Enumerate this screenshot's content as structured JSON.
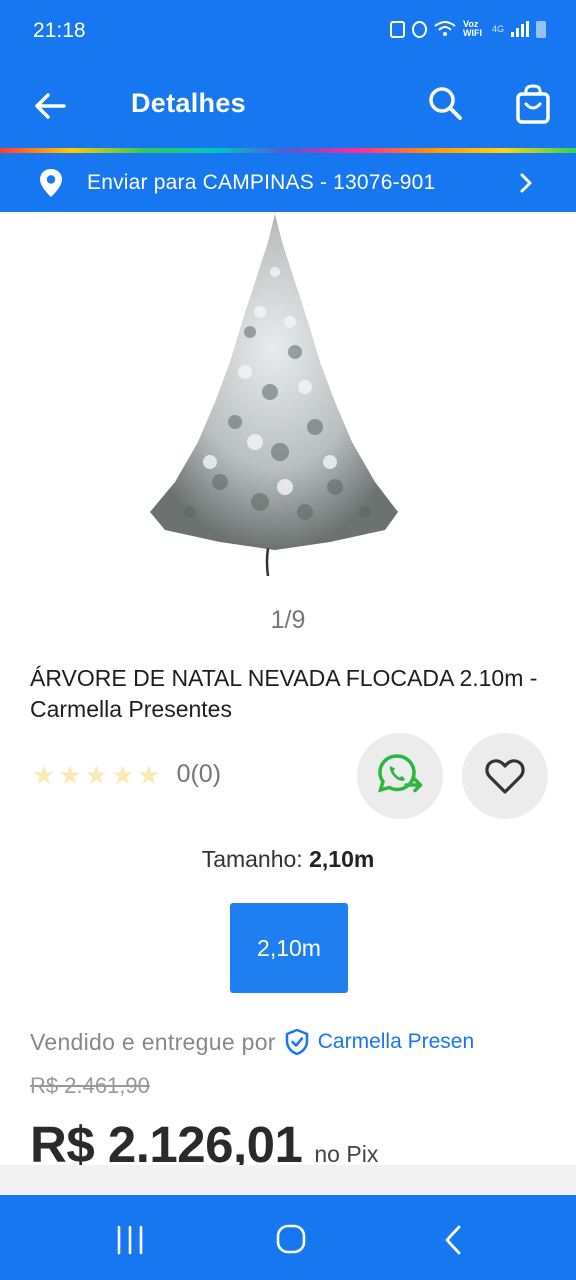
{
  "status_bar": {
    "time": "21:18",
    "network_label": "Voz WIFI",
    "network_type": "4G",
    "icons": [
      "sim-icon",
      "alarm-icon",
      "wifi-calling-icon",
      "signal-icon",
      "battery-icon"
    ]
  },
  "header": {
    "title": "Detalhes",
    "back_icon": "arrow-left-icon",
    "search_icon": "search-icon",
    "cart_icon": "shopping-bag-icon"
  },
  "delivery": {
    "text": "Enviar para CAMPINAS - 13076-901",
    "icon": "location-pin-icon"
  },
  "gallery": {
    "indicator": "1/9"
  },
  "product": {
    "title": "ÁRVORE DE NATAL NEVADA FLOCADA 2.10m - Carmella Presentes",
    "rating_value": 0,
    "rating_text": "0(0)",
    "size_label_prefix": "Tamanho:",
    "size_label_value": "2,10m",
    "size_options": [
      "2,10m"
    ],
    "seller_prefix": "Vendido e entregue por",
    "seller_name": "Carmella Presen",
    "old_price": "R$ 2.461,90",
    "price": "R$ 2.126,01",
    "price_suffix": "no Pix"
  },
  "colors": {
    "primary": "#1677f0",
    "star_empty": "#fbe9b8",
    "whatsapp": "#2cb742"
  }
}
